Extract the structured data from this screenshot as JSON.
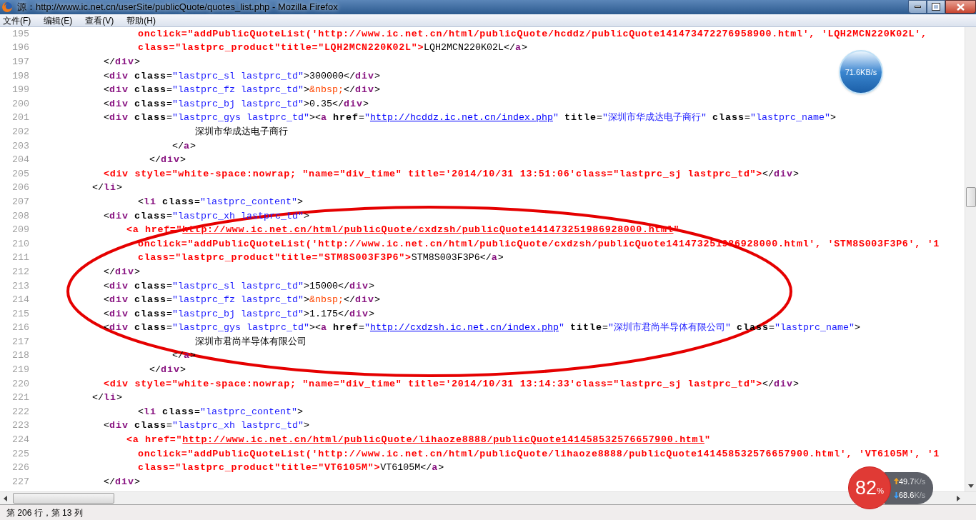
{
  "window": {
    "title": "源：http://www.ic.net.cn/userSite/publicQuote/quotes_list.php - Mozilla Firefox"
  },
  "menu": [
    {
      "label": "文件(F)"
    },
    {
      "label": "编辑(E)"
    },
    {
      "label": "查看(V)"
    },
    {
      "label": "帮助(H)"
    }
  ],
  "code_lines": [
    {
      "number": "195",
      "segments": [
        {
          "kind": "err",
          "text": "                  onclick=\"addPublicQuoteList('http://www.ic.net.cn/html/publicQuote/hcddz/publicQuote141473472276958900.html', 'LQH2MCN220K02L',"
        }
      ]
    },
    {
      "number": "196",
      "segments": [
        {
          "kind": "err",
          "text": "                  class=\"lastprc_product\"title=\"LQH2MCN220K02L\">"
        },
        {
          "kind": "p",
          "text": "LQH2MCN220K02L</"
        },
        {
          "kind": "tag",
          "text": "a"
        },
        {
          "kind": "p",
          "text": ">"
        }
      ]
    },
    {
      "number": "197",
      "segments": [
        {
          "kind": "p",
          "text": "            </"
        },
        {
          "kind": "tag",
          "text": "div"
        },
        {
          "kind": "p",
          "text": ">"
        }
      ]
    },
    {
      "number": "198",
      "segments": [
        {
          "kind": "p",
          "text": "            <"
        },
        {
          "kind": "tag",
          "text": "div"
        },
        {
          "kind": "attr",
          "text": " class"
        },
        {
          "kind": "p",
          "text": "="
        },
        {
          "kind": "val",
          "text": "\"lastprc_sl lastprc_td\""
        },
        {
          "kind": "p",
          "text": ">300000</"
        },
        {
          "kind": "tag",
          "text": "div"
        },
        {
          "kind": "p",
          "text": ">"
        }
      ]
    },
    {
      "number": "199",
      "segments": [
        {
          "kind": "p",
          "text": "            <"
        },
        {
          "kind": "tag",
          "text": "div"
        },
        {
          "kind": "attr",
          "text": " class"
        },
        {
          "kind": "p",
          "text": "="
        },
        {
          "kind": "val",
          "text": "\"lastprc_fz lastprc_td\""
        },
        {
          "kind": "p",
          "text": ">"
        },
        {
          "kind": "ent",
          "text": "&nbsp;"
        },
        {
          "kind": "p",
          "text": "</"
        },
        {
          "kind": "tag",
          "text": "div"
        },
        {
          "kind": "p",
          "text": ">"
        }
      ]
    },
    {
      "number": "200",
      "segments": [
        {
          "kind": "p",
          "text": "            <"
        },
        {
          "kind": "tag",
          "text": "div"
        },
        {
          "kind": "attr",
          "text": " class"
        },
        {
          "kind": "p",
          "text": "="
        },
        {
          "kind": "val",
          "text": "\"lastprc_bj lastprc_td\""
        },
        {
          "kind": "p",
          "text": ">0.35</"
        },
        {
          "kind": "tag",
          "text": "div"
        },
        {
          "kind": "p",
          "text": ">"
        }
      ]
    },
    {
      "number": "201",
      "segments": [
        {
          "kind": "p",
          "text": "            <"
        },
        {
          "kind": "tag",
          "text": "div"
        },
        {
          "kind": "attr",
          "text": " class"
        },
        {
          "kind": "p",
          "text": "="
        },
        {
          "kind": "val",
          "text": "\"lastprc_gys lastprc_td\""
        },
        {
          "kind": "p",
          "text": "><"
        },
        {
          "kind": "tag",
          "text": "a"
        },
        {
          "kind": "attr",
          "text": " href"
        },
        {
          "kind": "p",
          "text": "="
        },
        {
          "kind": "val",
          "text": "\""
        },
        {
          "kind": "link",
          "text": "http://hcddz.ic.net.cn/index.php"
        },
        {
          "kind": "val",
          "text": "\""
        },
        {
          "kind": "attr",
          "text": " title"
        },
        {
          "kind": "p",
          "text": "="
        },
        {
          "kind": "val",
          "text": "\"深圳市华成达电子商行\""
        },
        {
          "kind": "attr",
          "text": " class"
        },
        {
          "kind": "p",
          "text": "="
        },
        {
          "kind": "val",
          "text": "\"lastprc_name\""
        },
        {
          "kind": "p",
          "text": ">"
        }
      ]
    },
    {
      "number": "202",
      "segments": [
        {
          "kind": "text",
          "text": "                            深圳市华成达电子商行"
        }
      ]
    },
    {
      "number": "203",
      "segments": [
        {
          "kind": "p",
          "text": "                        </"
        },
        {
          "kind": "tag",
          "text": "a"
        },
        {
          "kind": "p",
          "text": ">"
        }
      ]
    },
    {
      "number": "204",
      "segments": [
        {
          "kind": "p",
          "text": "                    </"
        },
        {
          "kind": "tag",
          "text": "div"
        },
        {
          "kind": "p",
          "text": ">"
        }
      ]
    },
    {
      "number": "205",
      "segments": [
        {
          "kind": "err",
          "text": "            <div style=\"white-space:nowrap; \"name=\"div_time\" title='2014/10/31 13:51:06'class=\"lastprc_sj lastprc_td\">"
        },
        {
          "kind": "p",
          "text": "</"
        },
        {
          "kind": "tag",
          "text": "div"
        },
        {
          "kind": "p",
          "text": ">"
        }
      ]
    },
    {
      "number": "206",
      "segments": [
        {
          "kind": "p",
          "text": "          </"
        },
        {
          "kind": "tag",
          "text": "li"
        },
        {
          "kind": "p",
          "text": ">"
        }
      ]
    },
    {
      "number": "207",
      "segments": [
        {
          "kind": "p",
          "text": "                  <"
        },
        {
          "kind": "tag",
          "text": "li"
        },
        {
          "kind": "attr",
          "text": " class"
        },
        {
          "kind": "p",
          "text": "="
        },
        {
          "kind": "val",
          "text": "\"lastprc_content\""
        },
        {
          "kind": "p",
          "text": ">"
        }
      ]
    },
    {
      "number": "208",
      "segments": [
        {
          "kind": "p",
          "text": "            <"
        },
        {
          "kind": "tag",
          "text": "div"
        },
        {
          "kind": "attr",
          "text": " class"
        },
        {
          "kind": "p",
          "text": "="
        },
        {
          "kind": "val",
          "text": "\"lastprc_xh lastprc_td\""
        },
        {
          "kind": "p",
          "text": ">"
        }
      ]
    },
    {
      "number": "209",
      "segments": [
        {
          "kind": "err",
          "text": "                <a href=\""
        },
        {
          "kind": "errlink",
          "text": "http://www.ic.net.cn/html/publicQuote/cxdzsh/publicQuote141473251986928000.html"
        },
        {
          "kind": "err",
          "text": "\""
        }
      ]
    },
    {
      "number": "210",
      "segments": [
        {
          "kind": "err",
          "text": "                  onclick=\"addPublicQuoteList('http://www.ic.net.cn/html/publicQuote/cxdzsh/publicQuote141473251986928000.html', 'STM8S003F3P6', '1"
        }
      ]
    },
    {
      "number": "211",
      "segments": [
        {
          "kind": "err",
          "text": "                  class=\"lastprc_product\"title=\"STM8S003F3P6\">"
        },
        {
          "kind": "p",
          "text": "STM8S003F3P6</"
        },
        {
          "kind": "tag",
          "text": "a"
        },
        {
          "kind": "p",
          "text": ">"
        }
      ]
    },
    {
      "number": "212",
      "segments": [
        {
          "kind": "p",
          "text": "            </"
        },
        {
          "kind": "tag",
          "text": "div"
        },
        {
          "kind": "p",
          "text": ">"
        }
      ]
    },
    {
      "number": "213",
      "segments": [
        {
          "kind": "p",
          "text": "            <"
        },
        {
          "kind": "tag",
          "text": "div"
        },
        {
          "kind": "attr",
          "text": " class"
        },
        {
          "kind": "p",
          "text": "="
        },
        {
          "kind": "val",
          "text": "\"lastprc_sl lastprc_td\""
        },
        {
          "kind": "p",
          "text": ">15000</"
        },
        {
          "kind": "tag",
          "text": "div"
        },
        {
          "kind": "p",
          "text": ">"
        }
      ]
    },
    {
      "number": "214",
      "segments": [
        {
          "kind": "p",
          "text": "            <"
        },
        {
          "kind": "tag",
          "text": "div"
        },
        {
          "kind": "attr",
          "text": " class"
        },
        {
          "kind": "p",
          "text": "="
        },
        {
          "kind": "val",
          "text": "\"lastprc_fz lastprc_td\""
        },
        {
          "kind": "p",
          "text": ">"
        },
        {
          "kind": "ent",
          "text": "&nbsp;"
        },
        {
          "kind": "p",
          "text": "</"
        },
        {
          "kind": "tag",
          "text": "div"
        },
        {
          "kind": "p",
          "text": ">"
        }
      ]
    },
    {
      "number": "215",
      "segments": [
        {
          "kind": "p",
          "text": "            <"
        },
        {
          "kind": "tag",
          "text": "div"
        },
        {
          "kind": "attr",
          "text": " class"
        },
        {
          "kind": "p",
          "text": "="
        },
        {
          "kind": "val",
          "text": "\"lastprc_bj lastprc_td\""
        },
        {
          "kind": "p",
          "text": ">1.175</"
        },
        {
          "kind": "tag",
          "text": "div"
        },
        {
          "kind": "p",
          "text": ">"
        }
      ]
    },
    {
      "number": "216",
      "segments": [
        {
          "kind": "p",
          "text": "            <"
        },
        {
          "kind": "tag",
          "text": "div"
        },
        {
          "kind": "attr",
          "text": " class"
        },
        {
          "kind": "p",
          "text": "="
        },
        {
          "kind": "val",
          "text": "\"lastprc_gys lastprc_td\""
        },
        {
          "kind": "p",
          "text": "><"
        },
        {
          "kind": "tag",
          "text": "a"
        },
        {
          "kind": "attr",
          "text": " href"
        },
        {
          "kind": "p",
          "text": "="
        },
        {
          "kind": "val",
          "text": "\""
        },
        {
          "kind": "link",
          "text": "http://cxdzsh.ic.net.cn/index.php"
        },
        {
          "kind": "val",
          "text": "\""
        },
        {
          "kind": "attr",
          "text": " title"
        },
        {
          "kind": "p",
          "text": "="
        },
        {
          "kind": "val",
          "text": "\"深圳市君尚半导体有限公司\""
        },
        {
          "kind": "attr",
          "text": " class"
        },
        {
          "kind": "p",
          "text": "="
        },
        {
          "kind": "val",
          "text": "\"lastprc_name\""
        },
        {
          "kind": "p",
          "text": ">"
        }
      ]
    },
    {
      "number": "217",
      "segments": [
        {
          "kind": "text",
          "text": "                            深圳市君尚半导体有限公司"
        }
      ]
    },
    {
      "number": "218",
      "segments": [
        {
          "kind": "p",
          "text": "                        </"
        },
        {
          "kind": "tag",
          "text": "a"
        },
        {
          "kind": "p",
          "text": ">"
        }
      ]
    },
    {
      "number": "219",
      "segments": [
        {
          "kind": "p",
          "text": "                    </"
        },
        {
          "kind": "tag",
          "text": "div"
        },
        {
          "kind": "p",
          "text": ">"
        }
      ]
    },
    {
      "number": "220",
      "segments": [
        {
          "kind": "err",
          "text": "            <div style=\"white-space:nowrap; \"name=\"div_time\" title='2014/10/31 13:14:33'class=\"lastprc_sj lastprc_td\">"
        },
        {
          "kind": "p",
          "text": "</"
        },
        {
          "kind": "tag",
          "text": "div"
        },
        {
          "kind": "p",
          "text": ">"
        }
      ]
    },
    {
      "number": "221",
      "segments": [
        {
          "kind": "p",
          "text": "          </"
        },
        {
          "kind": "tag",
          "text": "li"
        },
        {
          "kind": "p",
          "text": ">"
        }
      ]
    },
    {
      "number": "222",
      "segments": [
        {
          "kind": "p",
          "text": "                  <"
        },
        {
          "kind": "tag",
          "text": "li"
        },
        {
          "kind": "attr",
          "text": " class"
        },
        {
          "kind": "p",
          "text": "="
        },
        {
          "kind": "val",
          "text": "\"lastprc_content\""
        },
        {
          "kind": "p",
          "text": ">"
        }
      ]
    },
    {
      "number": "223",
      "segments": [
        {
          "kind": "p",
          "text": "            <"
        },
        {
          "kind": "tag",
          "text": "div"
        },
        {
          "kind": "attr",
          "text": " class"
        },
        {
          "kind": "p",
          "text": "="
        },
        {
          "kind": "val",
          "text": "\"lastprc_xh lastprc_td\""
        },
        {
          "kind": "p",
          "text": ">"
        }
      ]
    },
    {
      "number": "224",
      "segments": [
        {
          "kind": "err",
          "text": "                <a href=\""
        },
        {
          "kind": "errlink",
          "text": "http://www.ic.net.cn/html/publicQuote/lihaoze8888/publicQuote141458532576657900.html"
        },
        {
          "kind": "err",
          "text": "\""
        }
      ]
    },
    {
      "number": "225",
      "segments": [
        {
          "kind": "err",
          "text": "                  onclick=\"addPublicQuoteList('http://www.ic.net.cn/html/publicQuote/lihaoze8888/publicQuote141458532576657900.html', 'VT6105M', '1"
        }
      ]
    },
    {
      "number": "226",
      "segments": [
        {
          "kind": "err",
          "text": "                  class=\"lastprc_product\"title=\"VT6105M\">"
        },
        {
          "kind": "p",
          "text": "VT6105M</"
        },
        {
          "kind": "tag",
          "text": "a"
        },
        {
          "kind": "p",
          "text": ">"
        }
      ]
    },
    {
      "number": "227",
      "segments": [
        {
          "kind": "p",
          "text": "            </"
        },
        {
          "kind": "tag",
          "text": "div"
        },
        {
          "kind": "p",
          "text": ">"
        }
      ]
    }
  ],
  "status_bar": "第 206 行，第 13 列",
  "speed_ball": {
    "reading": "71.6KB/s"
  },
  "monitor": {
    "percent": "82",
    "percent_sign": "%",
    "upload": "49.7",
    "upload_unit": "K/s",
    "download": "68.6",
    "download_unit": "K/s"
  }
}
